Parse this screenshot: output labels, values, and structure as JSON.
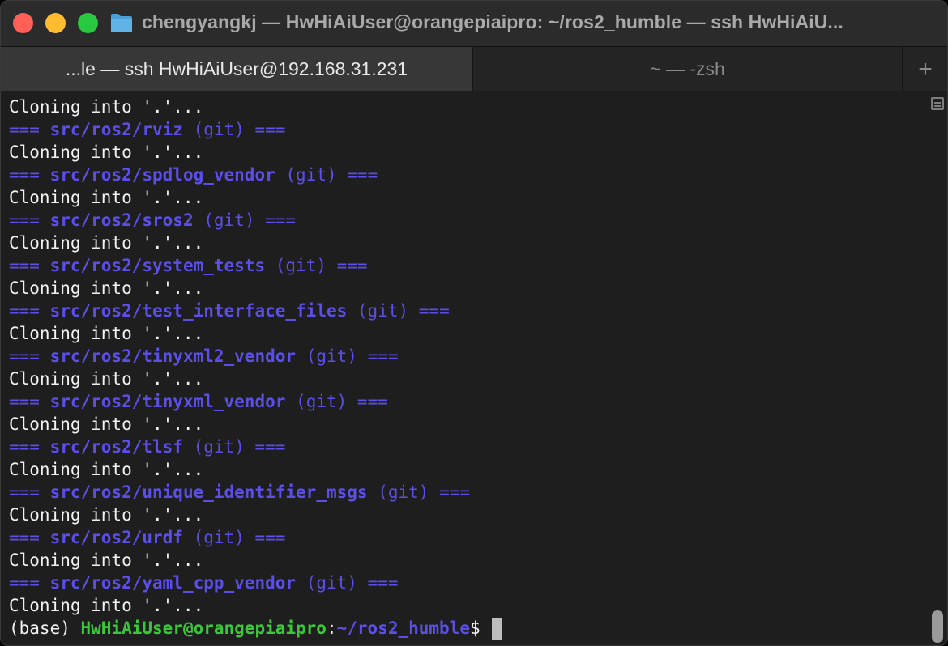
{
  "window": {
    "title": "chengyangkj — HwHiAiUser@orangepiaipro: ~/ros2_humble — ssh HwHiAiU..."
  },
  "tabs": [
    {
      "label": "...le — ssh HwHiAiUser@192.168.31.231",
      "active": true
    },
    {
      "label": "~ — -zsh",
      "active": false
    }
  ],
  "new_tab_label": "+",
  "icons": {
    "folder": "folder-icon",
    "new_tab": "plus-icon",
    "scroll_menu": "list-icon"
  },
  "colors": {
    "close": "#ff5f57",
    "minimize": "#febc2e",
    "zoom": "#28c840",
    "repo_header": "#5b4fe8",
    "prompt_user": "#3ac73a"
  },
  "terminal": {
    "clone_text": "Cloning into '.'...",
    "sep_open": "===",
    "sep_close": "===",
    "vcs_tag": "(git)",
    "entries": [
      {
        "type": "clone"
      },
      {
        "type": "header",
        "path": "src/ros2/rviz"
      },
      {
        "type": "clone"
      },
      {
        "type": "header",
        "path": "src/ros2/spdlog_vendor"
      },
      {
        "type": "clone"
      },
      {
        "type": "header",
        "path": "src/ros2/sros2"
      },
      {
        "type": "clone"
      },
      {
        "type": "header",
        "path": "src/ros2/system_tests"
      },
      {
        "type": "clone"
      },
      {
        "type": "header",
        "path": "src/ros2/test_interface_files"
      },
      {
        "type": "clone"
      },
      {
        "type": "header",
        "path": "src/ros2/tinyxml2_vendor"
      },
      {
        "type": "clone"
      },
      {
        "type": "header",
        "path": "src/ros2/tinyxml_vendor"
      },
      {
        "type": "clone"
      },
      {
        "type": "header",
        "path": "src/ros2/tlsf"
      },
      {
        "type": "clone"
      },
      {
        "type": "header",
        "path": "src/ros2/unique_identifier_msgs"
      },
      {
        "type": "clone"
      },
      {
        "type": "header",
        "path": "src/ros2/urdf"
      },
      {
        "type": "clone"
      },
      {
        "type": "header",
        "path": "src/ros2/yaml_cpp_vendor"
      },
      {
        "type": "clone"
      }
    ],
    "prompt": {
      "env": "(base)",
      "user_host": "HwHiAiUser@orangepiaipro",
      "colon": ":",
      "cwd": "~/ros2_humble",
      "symbol": "$"
    }
  }
}
